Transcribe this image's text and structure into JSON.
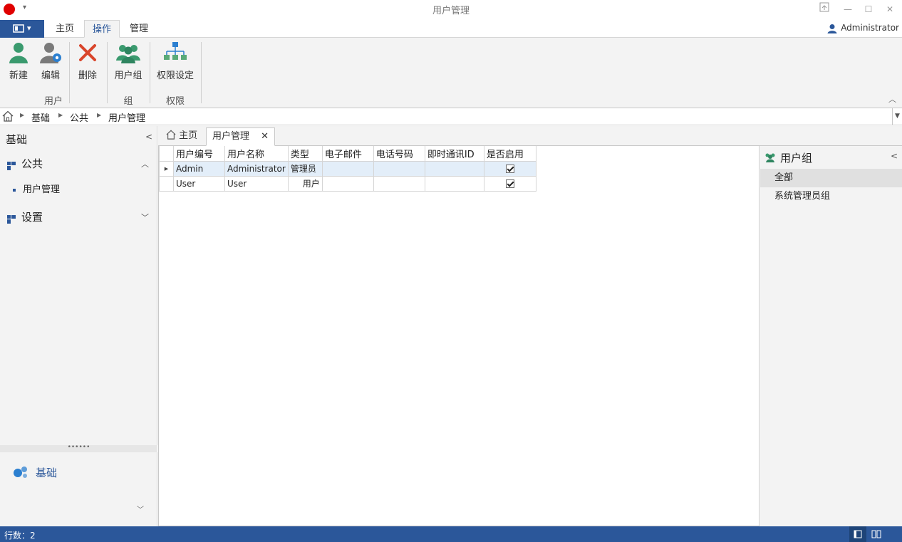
{
  "window": {
    "title": "用户管理"
  },
  "ribbon": {
    "tabs": [
      "主页",
      "操作",
      "管理"
    ],
    "active_tab": "操作",
    "user": "Administrator",
    "groups": [
      {
        "label": "用户",
        "buttons": [
          "新建",
          "编辑",
          "删除"
        ]
      },
      {
        "label": "组",
        "buttons": [
          "用户组"
        ]
      },
      {
        "label": "权限",
        "buttons": [
          "权限设定"
        ]
      }
    ]
  },
  "breadcrumb": [
    "基础",
    "公共",
    "用户管理"
  ],
  "leftnav": {
    "title": "基础",
    "groups": [
      {
        "label": "公共",
        "expanded": true,
        "items": [
          "用户管理"
        ]
      },
      {
        "label": "设置",
        "expanded": false,
        "items": []
      }
    ],
    "bottom_label": "基础"
  },
  "doc_tabs": [
    "主页",
    "用户管理"
  ],
  "grid": {
    "columns": [
      "用户编号",
      "用户名称",
      "类型",
      "电子邮件",
      "电话号码",
      "即时通讯ID",
      "是否启用"
    ],
    "rows": [
      {
        "id": "Admin",
        "name": "Administrator",
        "type": "管理员",
        "email": "",
        "phone": "",
        "im": "",
        "enabled": true
      },
      {
        "id": "User",
        "name": "User",
        "type": "用户",
        "email": "",
        "phone": "",
        "im": "",
        "enabled": true
      }
    ]
  },
  "rightpanel": {
    "title": "用户组",
    "items": [
      "全部",
      "系统管理员组"
    ],
    "active": "全部"
  },
  "status": {
    "text": "行数：2"
  },
  "colors": {
    "accent": "#2b579a",
    "logo": "#e00000"
  }
}
